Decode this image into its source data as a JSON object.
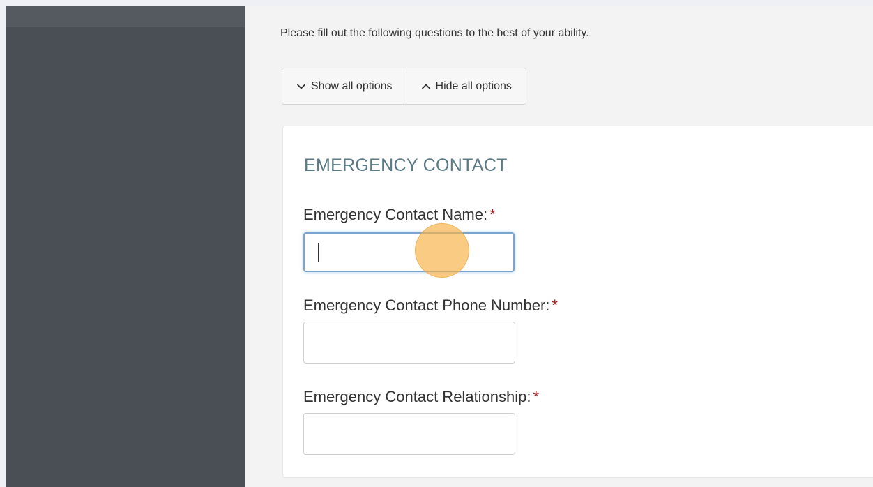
{
  "intro_text": "Please fill out the following questions to the best of your ability.",
  "options": {
    "show_all": {
      "label": "Show all options",
      "icon": "chevron-down-icon"
    },
    "hide_all": {
      "label": "Hide all options",
      "icon": "chevron-up-icon"
    }
  },
  "section": {
    "title": "EMERGENCY CONTACT",
    "fields": [
      {
        "label": "Emergency Contact Name:",
        "required_mark": "*",
        "value": "",
        "focused": true
      },
      {
        "label": "Emergency Contact Phone Number:",
        "required_mark": "*",
        "value": ""
      },
      {
        "label": "Emergency Contact Relationship:",
        "required_mark": "*",
        "value": ""
      }
    ]
  },
  "colors": {
    "sidebar": "#4a4e55",
    "section_title": "#5a7b86",
    "required": "#a11a1a",
    "focus_border": "#79a5cf",
    "click_marker": "#f7b248"
  }
}
